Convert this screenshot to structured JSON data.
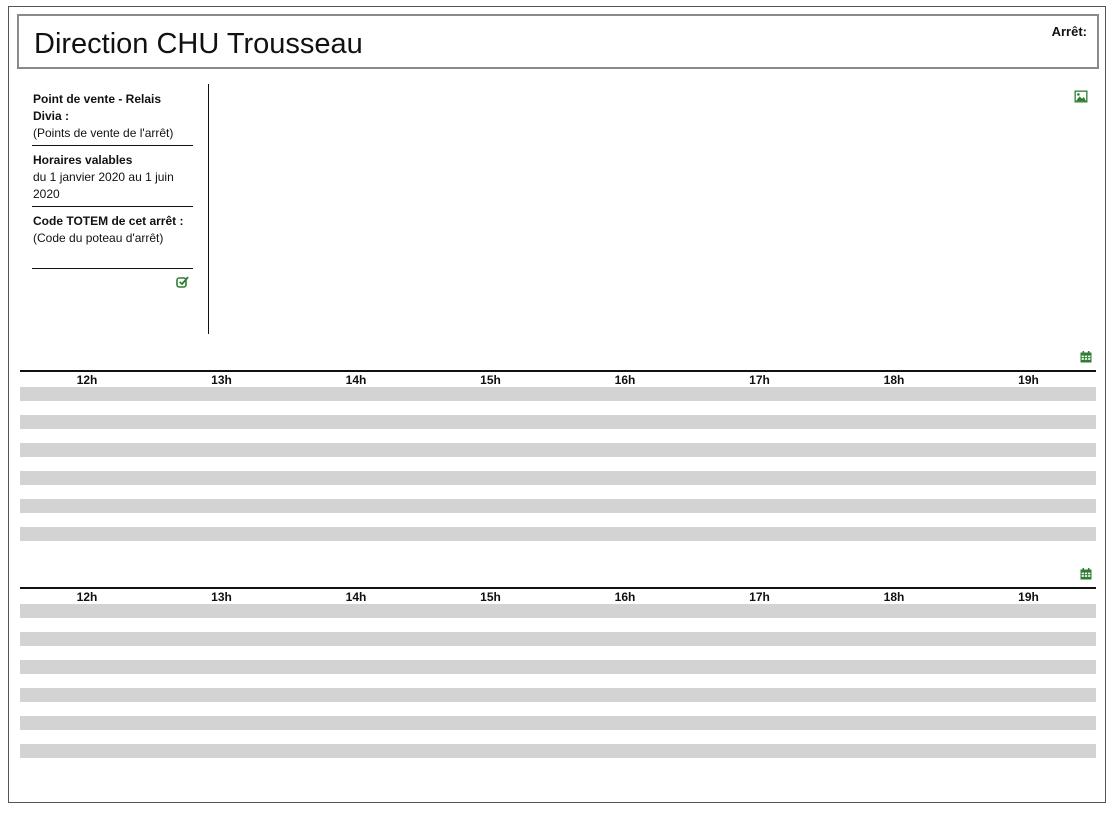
{
  "header": {
    "title": "Direction CHU Trousseau",
    "stop_label": "Arrêt:"
  },
  "sidebar": {
    "sales_point_label": "Point de vente - Relais Divia :",
    "sales_point_value": "(Points de vente de l'arrêt)",
    "schedule_label": "Horaires valables",
    "schedule_value": "du 1 janvier 2020 au 1 juin 2020",
    "totem_label": "Code TOTEM de cet arrêt :",
    "totem_value": "(Code du poteau d'arrêt)"
  },
  "icons": {
    "edit": "edit-icon",
    "image": "image-icon",
    "calendar": "calendar-icon",
    "accent_color": "#2e7d32"
  },
  "timetables": [
    {
      "hours": [
        "12h",
        "13h",
        "14h",
        "15h",
        "16h",
        "17h",
        "18h",
        "19h"
      ],
      "row_count": 6
    },
    {
      "hours": [
        "12h",
        "13h",
        "14h",
        "15h",
        "16h",
        "17h",
        "18h",
        "19h"
      ],
      "row_count": 6
    }
  ]
}
